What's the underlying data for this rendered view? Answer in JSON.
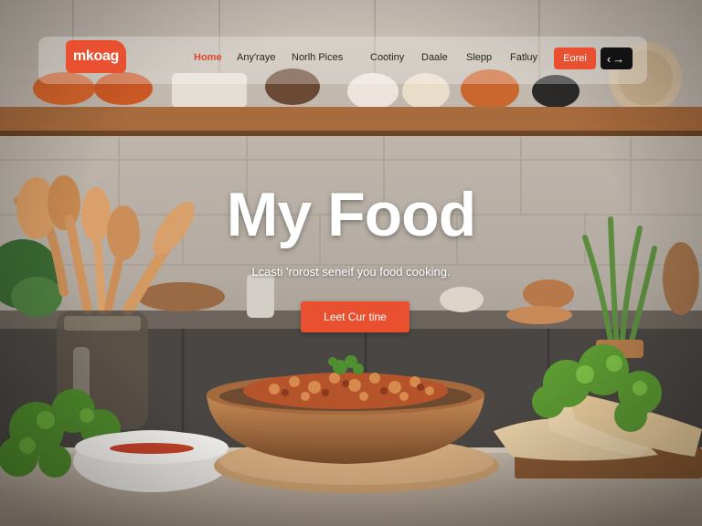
{
  "brand": {
    "logo_text": "mkoag",
    "accent": "#e8502f"
  },
  "nav": {
    "items": [
      "Home",
      "Any'raye",
      "Norlh Pices",
      "Cootiny",
      "Daale",
      "Slepp",
      "Fatluy"
    ],
    "active": "Home",
    "cta_label": "Eorei",
    "arrows_label": "‹ →"
  },
  "hero": {
    "title": "My Food",
    "subtitle": "Lcasti 'rorost seneif you food cooking.",
    "button_label": "Leet Cur tine"
  },
  "icons": [
    "chevron-left-icon",
    "arrow-right-icon"
  ]
}
